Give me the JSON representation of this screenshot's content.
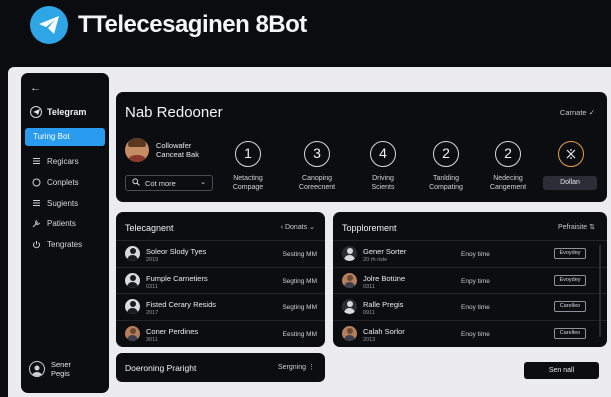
{
  "app": {
    "title": "TTelecesaginen 8Bot"
  },
  "sidebar": {
    "back_icon": "arrow-left-icon",
    "brand": "Telegram",
    "active_item": "Turing Bot",
    "items": [
      {
        "label": "Regicars",
        "icon": "list-icon"
      },
      {
        "label": "Conplets",
        "icon": "circle-icon"
      },
      {
        "label": "Sugients",
        "icon": "list-icon"
      },
      {
        "label": "Patients",
        "icon": "wrench-icon"
      },
      {
        "label": "Tengrates",
        "icon": "power-icon"
      }
    ],
    "user": {
      "line1": "Sener",
      "line2": "Pegis"
    }
  },
  "main_panel": {
    "title": "Nab Redooner",
    "right_label": "Carnate",
    "user": {
      "line1": "Collowafer",
      "line2": "Canceat Bak"
    },
    "select": {
      "value": "Cot more"
    },
    "steps": [
      {
        "number": "1",
        "line1": "Netacting",
        "line2": "Compage"
      },
      {
        "number": "3",
        "line1": "Canoping",
        "line2": "Coreecnent"
      },
      {
        "number": "4",
        "line1": "Driving",
        "line2": "Scients"
      },
      {
        "number": "2",
        "line1": "Tanlding",
        "line2": "Compating"
      },
      {
        "number": "2",
        "line1": "Nedecing",
        "line2": "Cangement"
      }
    ],
    "button": "Dollan"
  },
  "left_panel": {
    "title": "Telecagnent",
    "right_label": "Donats",
    "rows": [
      {
        "title": "Soleor Slody Tyes",
        "sub": "2019",
        "right": "Sesting MM"
      },
      {
        "title": "Fumple Carnetiers",
        "sub": "0311",
        "right": "Segting MM"
      },
      {
        "title": "Fisted Cerary Resids",
        "sub": "2017",
        "right": "Segting MM"
      },
      {
        "title": "Coner Perdines",
        "sub": "3011",
        "right": "Eesting MM"
      }
    ]
  },
  "right_panel": {
    "title": "Topplorement",
    "right_label": "Pefraisite",
    "rows": [
      {
        "title": "Gener Sorter",
        "sub": "20 rh risle",
        "middle": "Enoy time",
        "tag": "Evoydey"
      },
      {
        "title": "Jolre Botüne",
        "sub": "0311",
        "middle": "Enpy time",
        "tag": "Evoydey"
      },
      {
        "title": "Ralle Pregis",
        "sub": "0911",
        "middle": "Enoy time",
        "tag": "Carelleo"
      },
      {
        "title": "Calah Sorlor",
        "sub": "2013",
        "middle": "Enoy time",
        "tag": "Carelleo"
      }
    ]
  },
  "bottom_panel": {
    "title": "Doeroning Praright",
    "right_label": "Sergning"
  },
  "send_button": "Sen nall"
}
